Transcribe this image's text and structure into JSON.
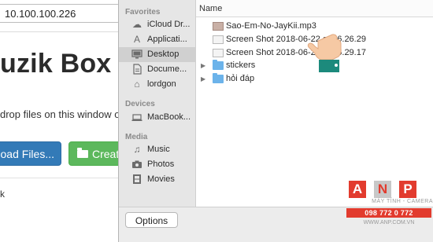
{
  "browser": {
    "address": "10.100.100.226",
    "brand_partial": "uzik Box",
    "instruction_partial": "drop files on this window or",
    "upload_button_partial": "oad Files...",
    "create_button_partial": "Create",
    "link_partial": "k"
  },
  "finder": {
    "sidebar": {
      "favorites_heading": "Favorites",
      "favorites": [
        {
          "label": "iCloud Dr...",
          "icon": "cloud-icon"
        },
        {
          "label": "Applicati...",
          "icon": "applications-icon"
        },
        {
          "label": "Desktop",
          "icon": "desktop-icon",
          "selected": true
        },
        {
          "label": "Docume...",
          "icon": "documents-icon"
        },
        {
          "label": "lordgon",
          "icon": "home-icon"
        }
      ],
      "devices_heading": "Devices",
      "devices": [
        {
          "label": "MacBook...",
          "icon": "laptop-icon"
        }
      ],
      "media_heading": "Media",
      "media": [
        {
          "label": "Music",
          "icon": "music-icon"
        },
        {
          "label": "Photos",
          "icon": "camera-icon"
        },
        {
          "label": "Movies",
          "icon": "film-icon"
        }
      ]
    },
    "column_header": "Name",
    "files": [
      {
        "name": "Sao-Em-No-JayKii.mp3",
        "type": "mp3"
      },
      {
        "name": "Screen Shot 2018-06-22 at 16.26.29",
        "type": "screenshot"
      },
      {
        "name": "Screen Shot 2018-06-22 at 16.29.17",
        "type": "screenshot"
      },
      {
        "name": "stickers",
        "type": "folder"
      },
      {
        "name": "hỏi đáp",
        "type": "folder"
      }
    ],
    "options_button": "Options"
  },
  "watermark": {
    "letters": [
      "A",
      "N",
      "P"
    ],
    "tagline": "MÁY TÍNH - CAMERA",
    "phone": "098 772 0 772",
    "url": "WWW.ANP.COM.VN"
  },
  "colors": {
    "primary_button": "#337ab7",
    "success_button": "#5cb85c",
    "sidebar_bg": "#e6e6e6",
    "selection": "#d0d0d0",
    "folder": "#6cb3ea",
    "watermark_red": "#e23b2e"
  }
}
